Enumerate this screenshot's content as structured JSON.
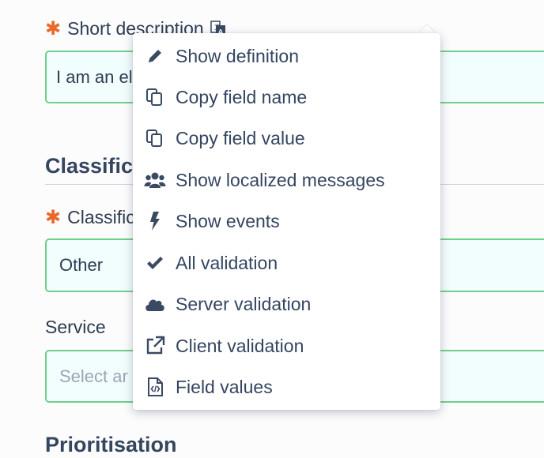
{
  "form": {
    "short_description": {
      "label": "Short description",
      "value": "I am an el"
    },
    "classification_section": {
      "title": "Classific"
    },
    "classification_field": {
      "label": "Classific",
      "value": "Other"
    },
    "service_field": {
      "label": "Service",
      "placeholder": "Select ar"
    },
    "prioritisation_section": {
      "title": "Prioritisation"
    }
  },
  "context_menu": {
    "items": [
      {
        "label": "Show definition",
        "icon": "pencil-icon"
      },
      {
        "label": "Copy field name",
        "icon": "copy-icon"
      },
      {
        "label": "Copy field value",
        "icon": "copy-icon"
      },
      {
        "label": "Show localized messages",
        "icon": "users-icon"
      },
      {
        "label": "Show events",
        "icon": "bolt-icon"
      },
      {
        "label": "All validation",
        "icon": "check-icon"
      },
      {
        "label": "Server validation",
        "icon": "cloud-icon"
      },
      {
        "label": "Client validation",
        "icon": "external-link-icon"
      },
      {
        "label": "Field values",
        "icon": "code-file-icon"
      }
    ]
  },
  "colors": {
    "required": "#e8692b",
    "field_border": "#6fd08a",
    "field_bg": "#f2fdfd",
    "text": "#2e3d52"
  }
}
